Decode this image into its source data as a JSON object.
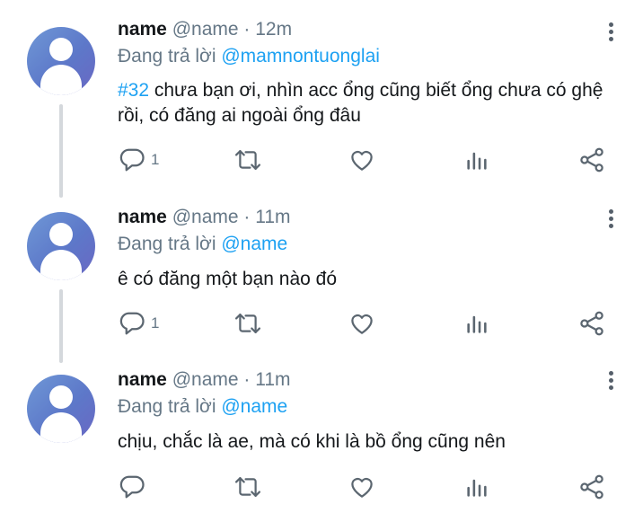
{
  "tweets": [
    {
      "name": "name",
      "handle": "@name",
      "dot": "·",
      "time": "12m",
      "replying_prefix": "Đang trả lời",
      "replying_to": "@mamnontuonglai",
      "hashtag": "#32",
      "text": " chưa bạn ơi, nhìn acc ổng cũng biết ổng chưa có ghệ rồi, có đăng ai ngoài ổng đâu",
      "reply_count": "1"
    },
    {
      "name": "name",
      "handle": "@name",
      "dot": "·",
      "time": "11m",
      "replying_prefix": "Đang trả lời",
      "replying_to": "@name",
      "hashtag": "",
      "text": "ê có đăng một bạn nào đó",
      "reply_count": "1"
    },
    {
      "name": "name",
      "handle": "@name",
      "dot": "·",
      "time": "11m",
      "replying_prefix": "Đang trả lời",
      "replying_to": "@name",
      "hashtag": "",
      "text": "chịu, chắc là ae, mà có khi là bồ ổng cũng nên",
      "reply_count": ""
    }
  ],
  "icons": {
    "reply": "reply-icon",
    "retweet": "retweet-icon",
    "like": "like-icon",
    "analytics": "analytics-icon",
    "share": "share-icon",
    "more": "more-vertical-icon"
  },
  "colors": {
    "link": "#1da1f2",
    "secondary_text": "#657786",
    "icon": "#5b6670",
    "thread_line": "#d4d8dc"
  }
}
